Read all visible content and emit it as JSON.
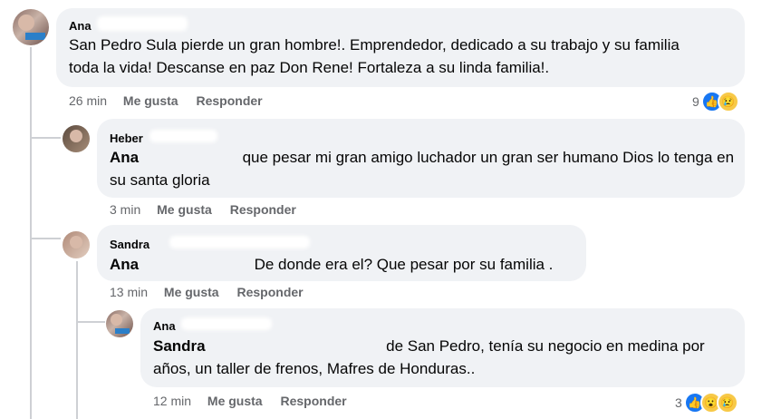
{
  "comments": [
    {
      "author": "Ana",
      "text": "San Pedro Sula pierde un gran hombre!. Emprendedor, dedicado a su trabajo y su familia toda la vida! Descanse en paz Don Rene! Fortaleza a su linda familia!.",
      "time": "26 min",
      "like_label": "Me gusta",
      "reply_label": "Responder",
      "reaction_count": "9",
      "reactions": [
        "like-icon",
        "sad-icon"
      ]
    },
    {
      "author": "Heber",
      "mention": "Ana",
      "text": "que pesar mi gran amigo luchador un gran ser humano Dios lo tenga en su santa gloria",
      "time": "3 min",
      "like_label": "Me gusta",
      "reply_label": "Responder"
    },
    {
      "author": "Sandra",
      "mention": "Ana",
      "text": "De donde era el? Que pesar por su familia .",
      "time": "13 min",
      "like_label": "Me gusta",
      "reply_label": "Responder"
    },
    {
      "author": "Ana",
      "mention": "Sandra",
      "text": "de San Pedro, tenía su negocio en medina por años, un taller de frenos, Mafres de Honduras..",
      "time": "12 min",
      "like_label": "Me gusta",
      "reply_label": "Responder",
      "reaction_count": "3",
      "reactions": [
        "like-icon",
        "wow-icon",
        "sad-icon"
      ]
    }
  ],
  "colors": {
    "bubble": "#f0f2f5",
    "meta": "#65676b",
    "like_blue": "#1877f2",
    "sad_yellow": "#f7c948"
  }
}
